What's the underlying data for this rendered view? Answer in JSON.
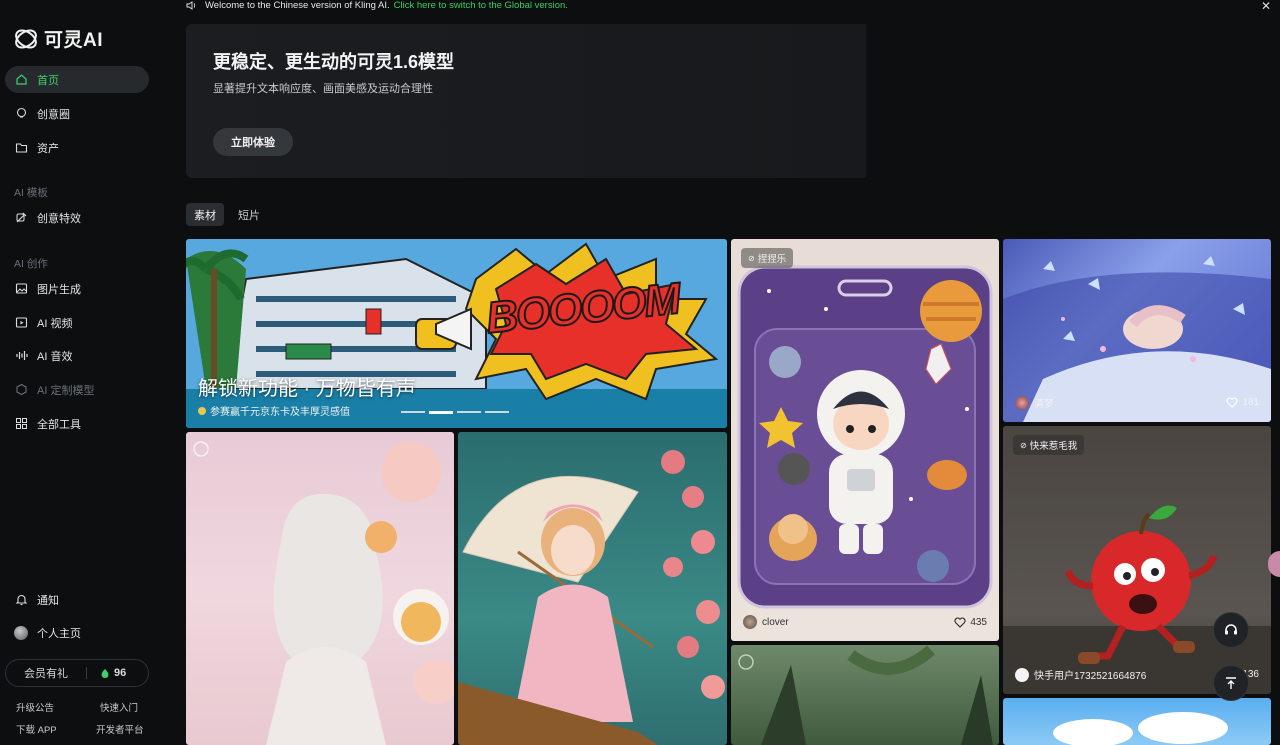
{
  "topbar": {
    "welcome": "Welcome to the Chinese version of Kling AI.",
    "switch_link": "Click here to switch to the Global version."
  },
  "brand": {
    "name": "可灵AI"
  },
  "nav": {
    "home": "首页",
    "community": "创意圈",
    "assets": "资产",
    "section_templates": "AI 模板",
    "effects": "创意特效",
    "section_create": "AI 创作",
    "image_gen": "图片生成",
    "video": "AI 视频",
    "audio": "AI 音效",
    "custom_model": "AI 定制模型",
    "all_tools": "全部工具",
    "notifications": "通知",
    "profile": "个人主页"
  },
  "vip": {
    "label": "会员有礼",
    "points": "96"
  },
  "footer_links": {
    "updates": "升级公告",
    "quickstart": "快速入门",
    "download": "下载 APP",
    "developer": "开发者平台"
  },
  "hero": {
    "title": "更稳定、更生动的可灵1.6模型",
    "subtitle": "显著提升文本响应度、画面美感及运动合理性",
    "cta": "立即体验"
  },
  "tabs": [
    "素材",
    "短片"
  ],
  "banner": {
    "title": "解锁新功能 · 万物皆有声",
    "subtitle": "参赛赢千元京东卡及丰厚灵感值",
    "comic_text": "BOOOOM"
  },
  "cards": {
    "astronaut": {
      "tag": "捏捏乐",
      "user": "clover",
      "likes": "435"
    },
    "dream": {
      "user": "清梦",
      "likes": "181"
    },
    "apple": {
      "tag": "快来惹毛我",
      "user": "快手用户1732521664876",
      "likes": "136"
    }
  },
  "colors": {
    "accent": "#3ed06a",
    "background": "#0c0e10",
    "panel": "#1b1d20"
  }
}
